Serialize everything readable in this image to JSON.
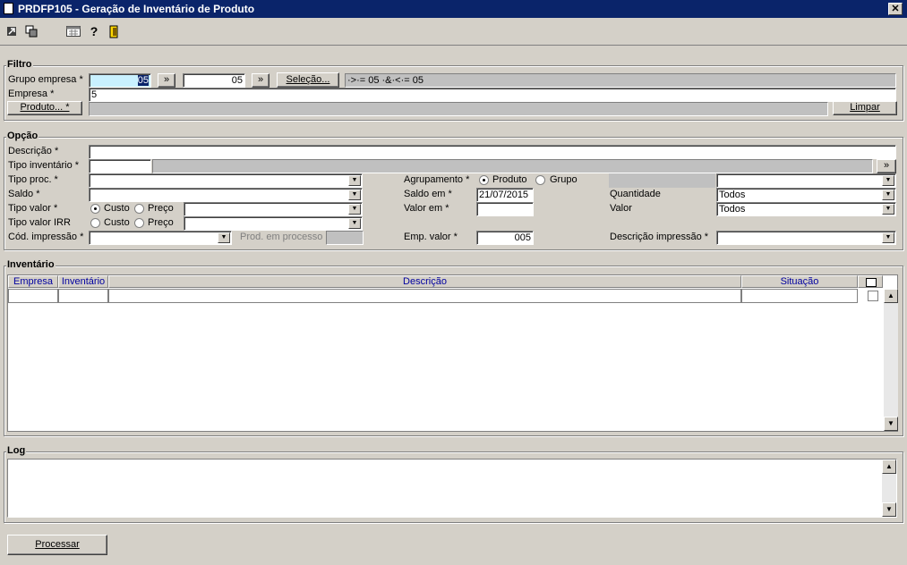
{
  "window": {
    "title": "PRDFP105 - Geração de Inventário de Produto",
    "close": "✕"
  },
  "toolbar": {
    "icons": [
      "return-icon",
      "copy-icon",
      "calendar-icon",
      "help-icon",
      "exit-icon"
    ]
  },
  "filtro": {
    "label": "Filtro",
    "grupo_empresa_label": "Grupo empresa *",
    "grupo_empresa_from": "05",
    "grupo_empresa_to": "05",
    "arrows": "»",
    "selecao_btn": "Seleção...",
    "selecao_expr": "·>·= 05 ·&·<·= 05",
    "empresa_label": "Empresa *",
    "empresa_value": "5",
    "produto_btn": "Produto... *",
    "limpar_btn": "Limpar"
  },
  "opcao": {
    "label": "Opção",
    "descricao_label": "Descrição *",
    "tipo_inventario_label": "Tipo inventário *",
    "tipo_proc_label": "Tipo proc. *",
    "saldo_label": "Saldo *",
    "tipo_valor_label": "Tipo valor *",
    "tipo_valor_irr_label": "Tipo valor IRR",
    "custo": "Custo",
    "preco": "Preço",
    "cod_impressao_label": "Cód. impressão *",
    "prod_em_processo_label": "Prod. em processo",
    "agrupamento_label": "Agrupamento *",
    "produto": "Produto",
    "grupo": "Grupo",
    "saldo_em_label": "Saldo em *",
    "saldo_em_value": "21/07/2015",
    "valor_em_label": "Valor em *",
    "emp_valor_label": "Emp. valor *",
    "emp_valor_value": "005",
    "quantidade_label": "Quantidade",
    "quantidade_value": "Todos",
    "valor_label": "Valor",
    "valor_value": "Todos",
    "descricao_impressao_label": "Descrição impressão *"
  },
  "inventario": {
    "label": "Inventário",
    "columns": [
      "Empresa",
      "Inventário",
      "Descrição",
      "Situação"
    ]
  },
  "log": {
    "label": "Log"
  },
  "footer": {
    "processar_btn": "Processar"
  }
}
